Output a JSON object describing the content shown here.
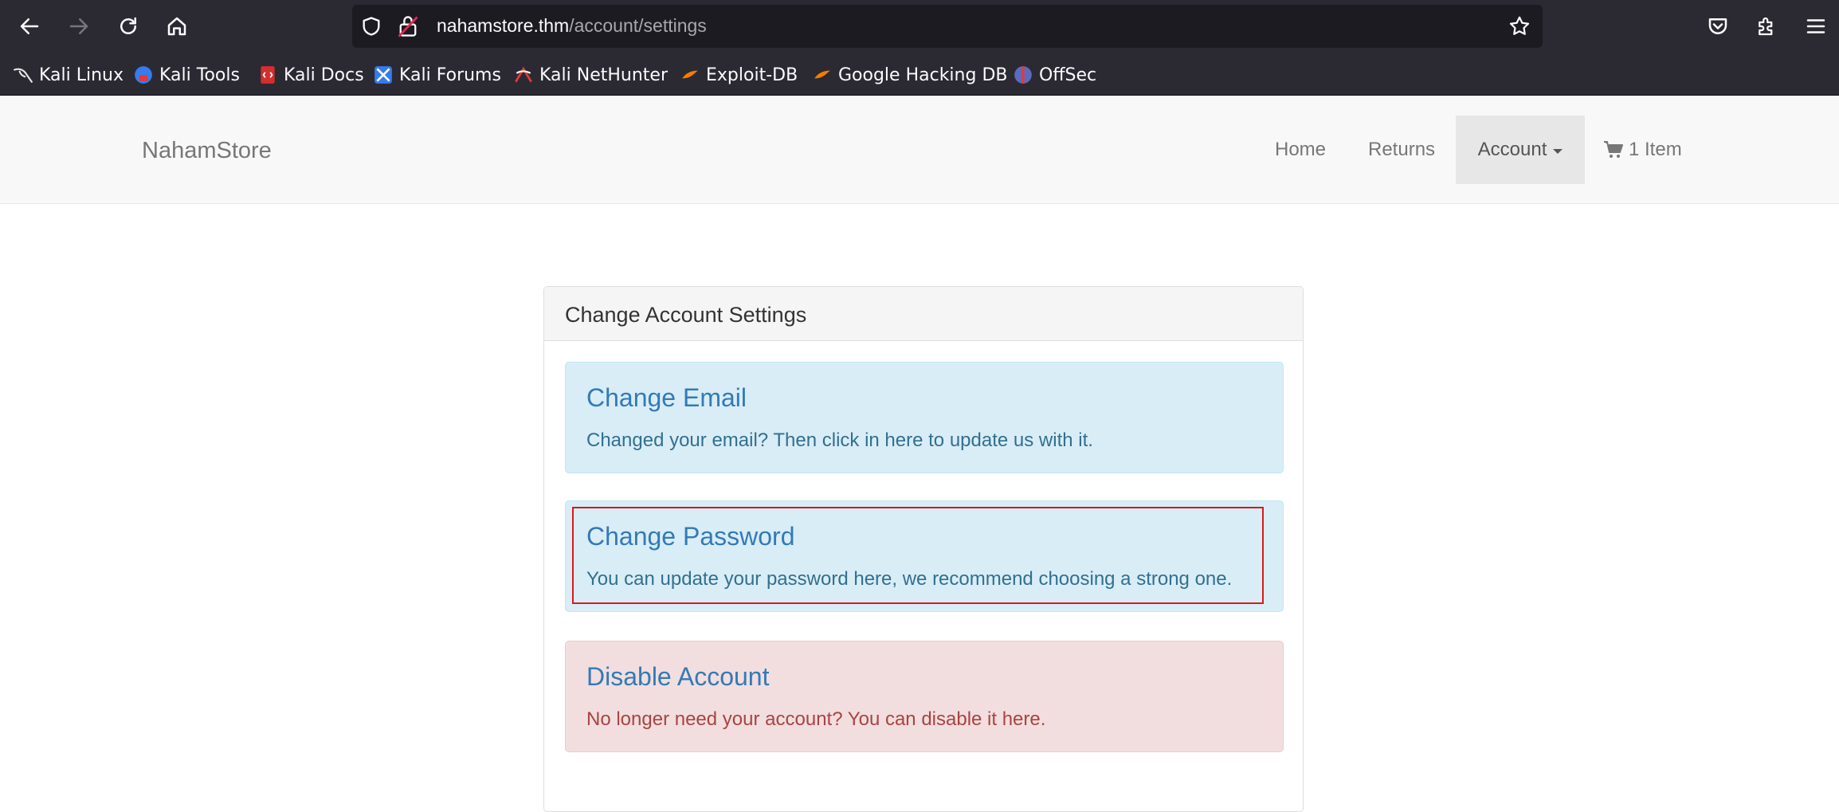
{
  "browser": {
    "url_host": "nahamstore.thm",
    "url_path": "/account/settings",
    "bookmarks": [
      {
        "label": "Kali Linux",
        "icon": "kali-dragon-icon"
      },
      {
        "label": "Kali Tools",
        "icon": "kali-tools-icon"
      },
      {
        "label": "Kali Docs",
        "icon": "kali-docs-icon"
      },
      {
        "label": "Kali Forums",
        "icon": "kali-forums-icon"
      },
      {
        "label": "Kali NetHunter",
        "icon": "kali-nethunter-icon"
      },
      {
        "label": "Exploit-DB",
        "icon": "exploit-db-icon"
      },
      {
        "label": "Google Hacking DB",
        "icon": "ghdb-icon"
      },
      {
        "label": "OffSec",
        "icon": "offsec-icon"
      }
    ]
  },
  "navbar": {
    "brand": "NahamStore",
    "home": "Home",
    "returns": "Returns",
    "account": "Account",
    "cart": "1 Item"
  },
  "panel": {
    "heading": "Change Account Settings",
    "email": {
      "title": "Change Email",
      "desc": "Changed your email? Then click in here to update us with it."
    },
    "password": {
      "title": "Change Password",
      "desc": "You can update your password here, we recommend choosing a strong one."
    },
    "disable": {
      "title": "Disable Account",
      "desc": "No longer need your account? You can disable it here."
    }
  },
  "colors": {
    "chrome_bg": "#2b2a33",
    "urlbar_bg": "#1c1b22",
    "navbar_bg": "#f8f8f8",
    "link": "#337ab7",
    "info_bg": "#d9edf7",
    "danger_bg": "#f2dede",
    "highlight": "#d9191a"
  }
}
